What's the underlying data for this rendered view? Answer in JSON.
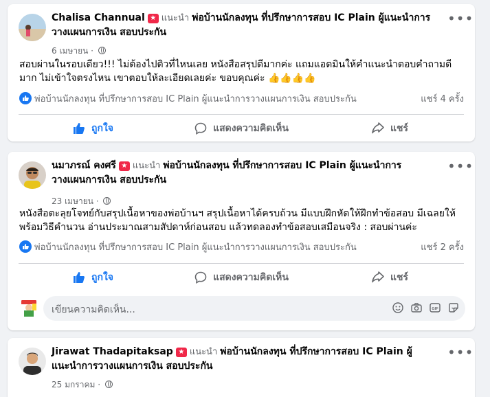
{
  "posts": [
    {
      "author": "Chalisa Channual",
      "recommend_label": "แนะนำ",
      "page_name": "พ่อบ้านนักลงทุน ที่ปรึกษาการสอบ IC Plain ผู้แนะนำการวางแผนการเงิน สอบประกัน",
      "date": "6 เมษายน",
      "text": "สอบผ่านในรอบเดียว!!! ไม่ต้องไปติวที่ไหนเลย หนังสือสรุปดีมากค่ะ แถมแอดมินให้คำแนะนำตอบคำถามดีมาก ไม่เข้าใจตรงไหน เขาตอบให้ละเอียดเลยค่ะ ขอบคุณค่ะ 👍👍👍👍",
      "reaction_page": "พ่อบ้านนักลงทุน ที่ปรึกษาการสอบ IC Plain ผู้แนะนำการวางแผนการเงิน สอบประกัน",
      "share_count": "แชร์ 4 ครั้ง"
    },
    {
      "author": "นมาภรณ์ คงศรี",
      "recommend_label": "แนะนำ",
      "page_name": "พ่อบ้านนักลงทุน ที่ปรึกษาการสอบ IC Plain ผู้แนะนำการวางแผนการเงิน สอบประกัน",
      "date": "23 เมษายน",
      "text": "หนังสือตะลุยโจทย์กับสรุปเนื้อหาของพ่อบ้านฯ สรุปเนื้อหาได้ครบถ้วน มีแบบฝึกหัดให้ฝึกทำข้อสอบ มีเฉลยให้ พร้อมวิธีคำนวน  อ่านประมาณสามสัปดาห์ก่อนสอบ แล้วทดลองทำข้อสอบเสมือนจริง : สอบผ่านค่ะ",
      "reaction_page": "พ่อบ้านนักลงทุน ที่ปรึกษาการสอบ IC Plain ผู้แนะนำการวางแผนการเงิน สอบประกัน",
      "share_count": "แชร์ 2 ครั้ง"
    },
    {
      "author": "Jirawat Thadapitaksap",
      "recommend_label": "แนะนำ",
      "page_name": "พ่อบ้านนักลงทุน ที่ปรึกษาการสอบ IC Plain ผู้แนะนำการวางแผนการเงิน สอบประกัน",
      "date": "25 มกราคม"
    }
  ],
  "actions": {
    "like": "ถูกใจ",
    "comment": "แสดงความคิดเห็น",
    "share": "แชร์"
  },
  "comment_placeholder": "เขียนความคิดเห็น...",
  "colors": {
    "accent": "#1877f2",
    "badge": "#f02849",
    "muted": "#65676b"
  }
}
